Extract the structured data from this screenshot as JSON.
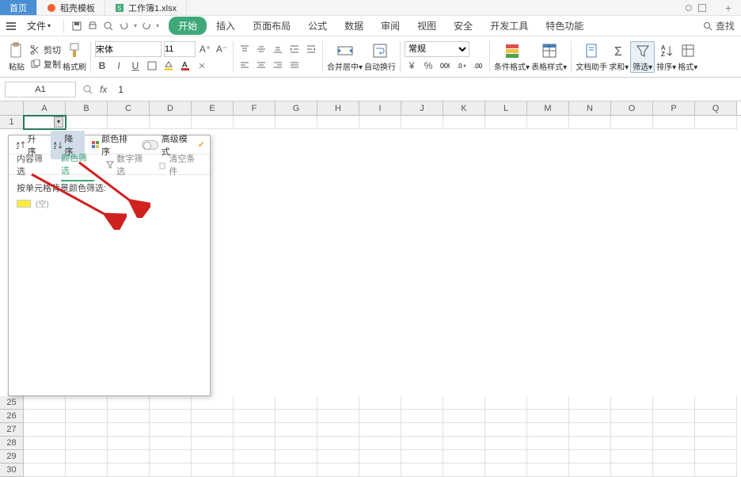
{
  "title_tabs": [
    {
      "label": "首页",
      "icon": "home-icon",
      "active": true
    },
    {
      "label": "稻壳模板",
      "icon": "shell-icon",
      "active": false
    },
    {
      "label": "工作簿1.xlsx",
      "icon": "sheet-icon",
      "active": false
    }
  ],
  "menu": {
    "file": "文件",
    "tabs": [
      "开始",
      "插入",
      "页面布局",
      "公式",
      "数据",
      "审阅",
      "视图",
      "安全",
      "开发工具",
      "特色功能"
    ],
    "search": "查找"
  },
  "ribbon": {
    "paste": "粘贴",
    "cut": "剪切",
    "copy": "复制",
    "format_painter": "格式刷",
    "font_name": "宋体",
    "font_size": "11",
    "merge": "合并居中",
    "wrap": "自动换行",
    "number_format": "常规",
    "cond_fmt": "条件格式",
    "table_style": "表格样式",
    "doc_helper": "文档助手",
    "sum": "求和",
    "filter": "筛选",
    "sort": "排序",
    "format": "格式"
  },
  "formula_bar": {
    "name": "A1",
    "value": "1"
  },
  "columns": [
    "A",
    "B",
    "C",
    "D",
    "E",
    "F",
    "G",
    "H",
    "I",
    "J",
    "K",
    "L",
    "M",
    "N",
    "O",
    "P",
    "Q"
  ],
  "rows_top": [
    "1"
  ],
  "rows_bottom": [
    "25",
    "26",
    "27",
    "28",
    "29",
    "30"
  ],
  "filter_panel": {
    "asc": "升序",
    "desc": "降序",
    "color_sort": "颜色排序",
    "advanced": "高级模式",
    "tab_content": "内容筛选",
    "tab_color": "颜色筛选",
    "num_filter": "数字筛选",
    "clear": "清空条件",
    "body_header": "按单元格背景颜色筛选:",
    "swatch_label": "(空)"
  }
}
